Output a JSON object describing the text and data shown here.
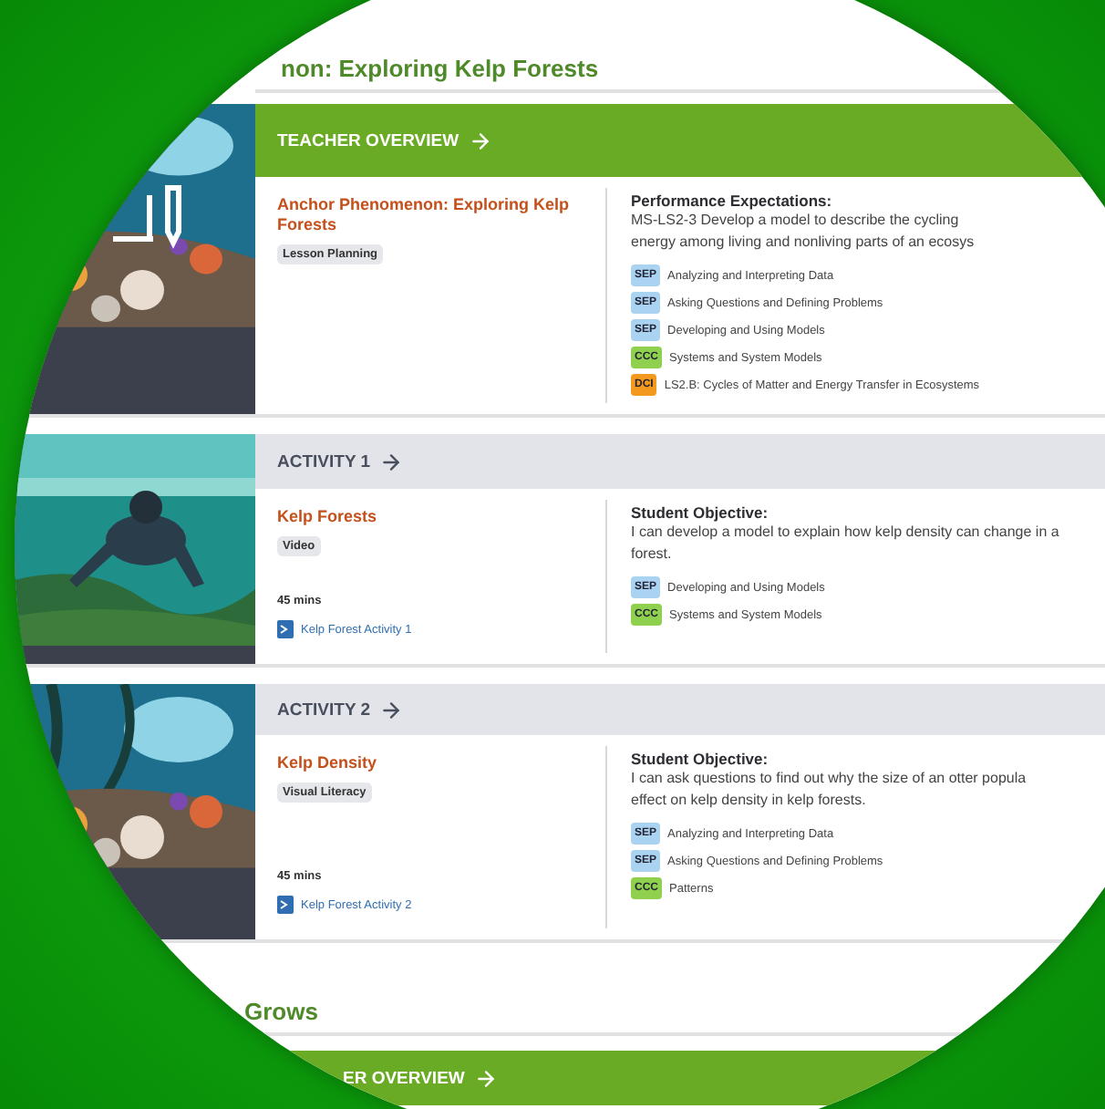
{
  "heading": "non: Exploring Kelp Forests",
  "sections": [
    {
      "kind": "overview",
      "header": "TEACHER OVERVIEW",
      "title_lines": [
        "Anchor Phenomenon: Exploring Kelp",
        "Forests"
      ],
      "tag": "Lesson Planning",
      "objective_label": "Performance Expectations:",
      "objective_lines": [
        "MS-LS2-3 Develop a model to describe the cycling",
        "energy among living and nonliving parts of an ecosys"
      ],
      "standards": [
        {
          "code": "SEP",
          "color": "#a9d3f0",
          "text": "Analyzing and Interpreting Data"
        },
        {
          "code": "SEP",
          "color": "#a9d3f0",
          "text": "Asking Questions and Defining Problems"
        },
        {
          "code": "SEP",
          "color": "#a9d3f0",
          "text": "Developing and Using Models"
        },
        {
          "code": "CCC",
          "color": "#8fd14f",
          "text": "Systems and System Models"
        },
        {
          "code": "DCI",
          "color": "#f39a1e",
          "text": "LS2.B: Cycles of Matter and Energy Transfer in Ecosystems"
        }
      ]
    },
    {
      "kind": "activity",
      "header": "ACTIVITY 1",
      "title_lines": [
        "Kelp Forests"
      ],
      "tag": "Video",
      "duration": "45 mins",
      "link": "Kelp Forest Activity 1",
      "objective_label": "Student Objective:",
      "objective_lines": [
        "I can develop a model to explain how kelp density can change in a",
        "forest."
      ],
      "standards": [
        {
          "code": "SEP",
          "color": "#a9d3f0",
          "text": "Developing and Using Models"
        },
        {
          "code": "CCC",
          "color": "#8fd14f",
          "text": "Systems and System Models"
        }
      ]
    },
    {
      "kind": "activity",
      "header": "ACTIVITY 2",
      "title_lines": [
        "Kelp Density"
      ],
      "tag": "Visual Literacy",
      "duration": "45 mins",
      "link": "Kelp Forest Activity 2",
      "objective_label": "Student Objective:",
      "objective_lines": [
        "I can ask questions to find out why the size of an otter popula",
        "effect on kelp density in kelp forests."
      ],
      "standards": [
        {
          "code": "SEP",
          "color": "#a9d3f0",
          "text": "Analyzing and Interpreting Data"
        },
        {
          "code": "SEP",
          "color": "#a9d3f0",
          "text": "Asking Questions and Defining Problems"
        },
        {
          "code": "CCC",
          "color": "#8fd14f",
          "text": "Patterns"
        }
      ]
    }
  ],
  "next_heading": "Grows",
  "next_header": "ER OVERVIEW"
}
